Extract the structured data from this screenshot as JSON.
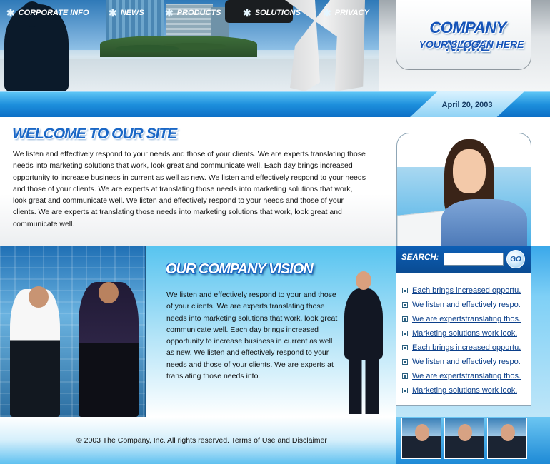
{
  "brand": {
    "name": "COMPANY NAME",
    "slogan": "YOUR SLOGAN HERE"
  },
  "nav": {
    "items": [
      {
        "label": "CORPORATE INFO"
      },
      {
        "label": "NEWS"
      },
      {
        "label": "PRODUCTS"
      },
      {
        "label": "SOLUTIONS"
      },
      {
        "label": "PRIVACY"
      }
    ],
    "date": "April 20, 2003"
  },
  "welcome": {
    "title": "WELCOME TO OUR SITE",
    "text": "We listen and effectively respond to your needs and those of your clients. We are experts translating those needs into marketing solutions that work, look great and communicate well. Each day brings increased opportunity to increase business in current as well as new.  We listen and effectively respond to your needs and those of your clients. We are experts at translating those needs into marketing solutions that work, look great and communicate well.  We listen and effectively respond to your needs and those of your clients. We are experts at translating  those needs into marketing solutions that work, look great and communicate well."
  },
  "vision": {
    "title": "OUR COMPANY VISION",
    "text": "We listen and effectively respond to your and those of your clients. We are experts translating those needs into marketing solutions that work, look great communicate well. Each day brings increased opportunity to increase business in current as well as new. We listen and effectively respond to your needs and those of your clients. We are experts at translating those needs into."
  },
  "search": {
    "label": "SEARCH:",
    "value": "",
    "placeholder": "",
    "button": "GO"
  },
  "links": [
    "Each brings increased opportu.",
    "We listen and effectively respo.",
    "We are expertstranslating thos.",
    "Marketing solutions work look.",
    "Each brings increased opportu.",
    "We listen and effectively respo.",
    "We are expertstranslating thos.",
    "Marketing solutions work look."
  ],
  "footer": {
    "text": "© 2003 The Company, Inc.  All rights reserved. Terms of Use and Disclaimer"
  },
  "icons": {
    "nav_bullet": "asterisk-icon",
    "link_bullet": "square-bullet-icon"
  },
  "colors": {
    "accent": "#1a67c6",
    "nav": "#1d8fdc",
    "link": "#0b3f8a"
  }
}
